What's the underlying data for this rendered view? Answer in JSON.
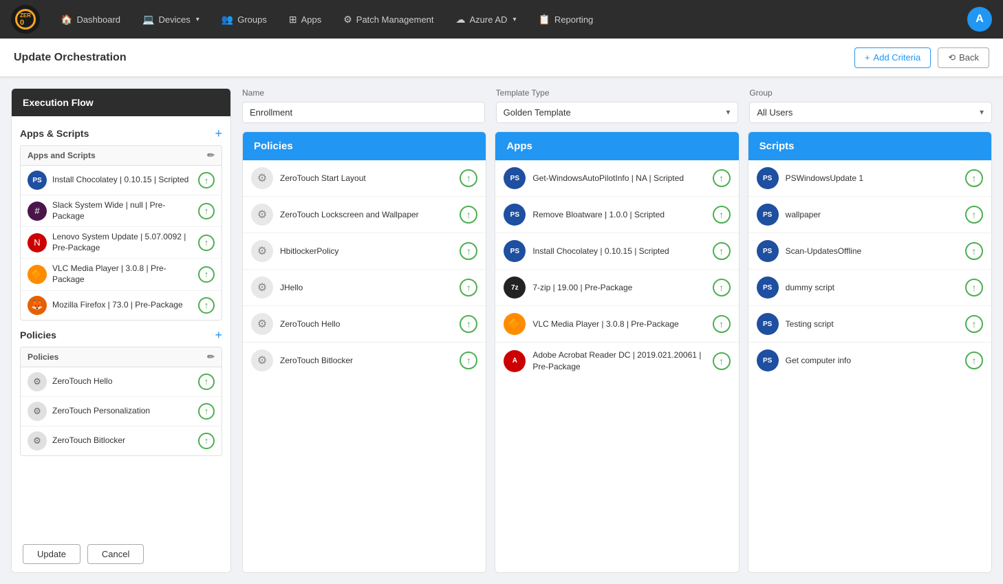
{
  "app": {
    "logo_text": "ZER",
    "logo_subtext": "0"
  },
  "topnav": {
    "items": [
      {
        "id": "dashboard",
        "label": "Dashboard",
        "icon": "🏠",
        "has_chevron": false
      },
      {
        "id": "devices",
        "label": "Devices",
        "icon": "💻",
        "has_chevron": true
      },
      {
        "id": "groups",
        "label": "Groups",
        "icon": "👥",
        "has_chevron": false
      },
      {
        "id": "apps",
        "label": "Apps",
        "icon": "⊞",
        "has_chevron": false
      },
      {
        "id": "patch-management",
        "label": "Patch Management",
        "icon": "⚙",
        "has_chevron": false
      },
      {
        "id": "azure-ad",
        "label": "Azure AD",
        "icon": "☁",
        "has_chevron": true
      },
      {
        "id": "reporting",
        "label": "Reporting",
        "icon": "📋",
        "has_chevron": false
      }
    ],
    "avatar_letter": "A"
  },
  "page": {
    "title": "Update Orchestration",
    "add_criteria_label": "+ Add Criteria",
    "back_label": "⟲ Back"
  },
  "form": {
    "name_label": "Name",
    "name_value": "Enrollment",
    "template_type_label": "Template Type",
    "template_type_value": "Golden Template",
    "group_label": "Group",
    "group_value": "All Users"
  },
  "left_panel": {
    "execution_flow_title": "Execution Flow",
    "apps_scripts_section": "Apps & Scripts",
    "policies_section": "Policies",
    "apps_subsection_label": "Apps and Scripts",
    "policies_subsection_label": "Policies",
    "apps_items": [
      {
        "label": "Install Chocolatey | 0.10.15 | Scripted",
        "icon_type": "powershell"
      },
      {
        "label": "Slack System Wide | null | Pre-Package",
        "icon_type": "slack"
      },
      {
        "label": "Lenovo System Update | 5.07.0092 | Pre-Package",
        "icon_type": "novell"
      },
      {
        "label": "VLC Media Player | 3.0.8 | Pre-Package",
        "icon_type": "vlc"
      },
      {
        "label": "Mozilla Firefox | 73.0 | Pre-Package",
        "icon_type": "firefox"
      }
    ],
    "policies_items": [
      {
        "label": "ZeroTouch Hello",
        "icon_type": "policy"
      },
      {
        "label": "ZeroTouch Personalization",
        "icon_type": "policy"
      },
      {
        "label": "ZeroTouch Bitlocker",
        "icon_type": "policy"
      }
    ],
    "update_label": "Update",
    "cancel_label": "Cancel"
  },
  "policies_column": {
    "title": "Policies",
    "items": [
      {
        "label": "ZeroTouch Start Layout",
        "icon_type": "policy"
      },
      {
        "label": "ZeroTouch Lockscreen and Wallpaper",
        "icon_type": "policy"
      },
      {
        "label": "HbitlockerPolicy",
        "icon_type": "policy"
      },
      {
        "label": "JHello",
        "icon_type": "policy"
      },
      {
        "label": "ZeroTouch Hello",
        "icon_type": "policy"
      },
      {
        "label": "ZeroTouch Bitlocker",
        "icon_type": "policy"
      }
    ]
  },
  "apps_column": {
    "title": "Apps",
    "items": [
      {
        "label": "Get-WindowsAutoPilotInfo | NA | Scripted",
        "icon_type": "ps"
      },
      {
        "label": "Remove Bloatware | 1.0.0 | Scripted",
        "icon_type": "ps"
      },
      {
        "label": "Install Chocolatey | 0.10.15 | Scripted",
        "icon_type": "ps"
      },
      {
        "label": "7-zip | 19.00 | Pre-Package",
        "icon_type": "seven-zip"
      },
      {
        "label": "VLC Media Player | 3.0.8 | Pre-Package",
        "icon_type": "vlc"
      },
      {
        "label": "Adobe Acrobat Reader DC | 2019.021.20061 | Pre-Package",
        "icon_type": "acrobat"
      }
    ]
  },
  "scripts_column": {
    "title": "Scripts",
    "items": [
      {
        "label": "PSWindowsUpdate 1",
        "icon_type": "ps"
      },
      {
        "label": "wallpaper",
        "icon_type": "ps"
      },
      {
        "label": "Scan-UpdatesOffline",
        "icon_type": "ps"
      },
      {
        "label": "dummy script",
        "icon_type": "ps"
      },
      {
        "label": "Testing script",
        "icon_type": "ps"
      },
      {
        "label": "Get computer info",
        "icon_type": "ps"
      }
    ]
  }
}
